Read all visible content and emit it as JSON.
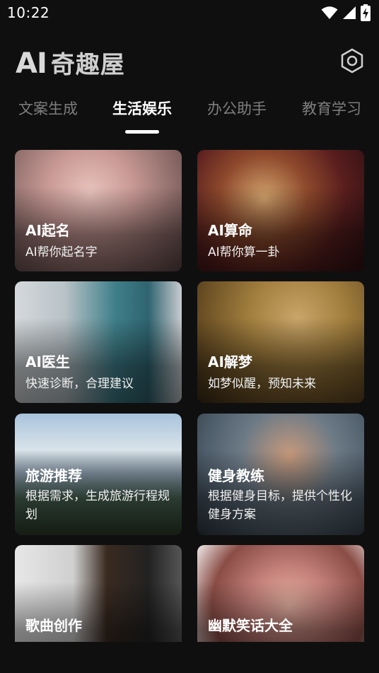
{
  "status": {
    "time": "10:22"
  },
  "header": {
    "logo_ai": "AI",
    "logo_cn": "奇趣屋"
  },
  "tabs": [
    {
      "label": "文案生成",
      "active": false
    },
    {
      "label": "生活娱乐",
      "active": true
    },
    {
      "label": "办公助手",
      "active": false
    },
    {
      "label": "教育学习",
      "active": false
    }
  ],
  "cards": [
    {
      "title": "AI起名",
      "desc": "AI帮你起名字"
    },
    {
      "title": "AI算命",
      "desc": "AI帮你算一卦"
    },
    {
      "title": "AI医生",
      "desc": "快速诊断，合理建议"
    },
    {
      "title": "AI解梦",
      "desc": "如梦似醒，预知未来"
    },
    {
      "title": "旅游推荐",
      "desc": "根据需求，生成旅游行程规划"
    },
    {
      "title": "健身教练",
      "desc": "根据健身目标，提供个性化健身方案"
    },
    {
      "title": "歌曲创作",
      "desc": ""
    },
    {
      "title": "幽默笑话大全",
      "desc": ""
    }
  ],
  "colors": {
    "background": "#0f0f10",
    "tab_inactive": "#7e7e7e",
    "tab_active": "#ffffff"
  },
  "icons": {
    "settings": "hexagon-gear-icon",
    "wifi": "wifi-icon",
    "signal": "cellular-signal-icon",
    "battery": "battery-charging-icon"
  }
}
